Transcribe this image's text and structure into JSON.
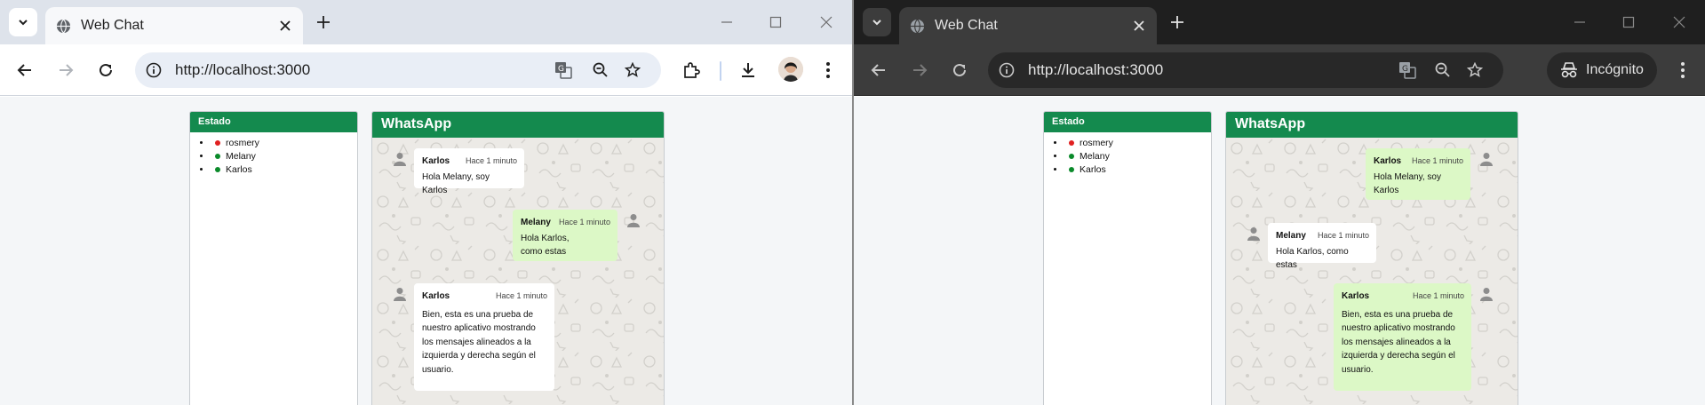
{
  "windows": [
    {
      "id": "left",
      "theme": "light",
      "tab_title": "Web Chat",
      "url": "http://localhost:3000",
      "estado": {
        "header": "Estado",
        "users": [
          {
            "name": "rosmery",
            "color": "#e02020"
          },
          {
            "name": "Melany",
            "color": "#0a8a2a"
          },
          {
            "name": "Karlos",
            "color": "#0a8a2a"
          }
        ]
      },
      "chat": {
        "header": "WhatsApp",
        "messages": [
          {
            "author": "Karlos",
            "time": "Hace 1 minuto",
            "text": "Hola Melany, soy Karlos",
            "side": "left"
          },
          {
            "author": "Melany",
            "time": "Hace 1 minuto",
            "text": "Hola Karlos, como estas",
            "side": "right"
          },
          {
            "author": "Karlos",
            "time": "Hace 1 minuto",
            "text": "Bien, esta es una prueba de nuestro aplicativo mostrando los mensajes alineados a la izquierda y derecha según el usuario.",
            "side": "left"
          }
        ]
      }
    },
    {
      "id": "right",
      "theme": "dark",
      "tab_title": "Web Chat",
      "url": "http://localhost:3000",
      "incognito_label": "Incógnito",
      "estado": {
        "header": "Estado",
        "users": [
          {
            "name": "rosmery",
            "color": "#e02020"
          },
          {
            "name": "Melany",
            "color": "#0a8a2a"
          },
          {
            "name": "Karlos",
            "color": "#0a8a2a"
          }
        ]
      },
      "chat": {
        "header": "WhatsApp",
        "messages": [
          {
            "author": "Karlos",
            "time": "Hace 1 minuto",
            "text": "Hola Melany, soy Karlos",
            "side": "right"
          },
          {
            "author": "Melany",
            "time": "Hace 1 minuto",
            "text": "Hola Karlos, como estas",
            "side": "left"
          },
          {
            "author": "Karlos",
            "time": "Hace 1 minuto",
            "text": "Bien, esta es una prueba de nuestro aplicativo mostrando los mensajes alineados a la izquierda y derecha según el usuario.",
            "side": "right"
          }
        ]
      }
    }
  ],
  "colors": {
    "header_green": "#148a4e",
    "bubble_mine": "#dcf8c6",
    "bubble_other": "#ffffff"
  }
}
